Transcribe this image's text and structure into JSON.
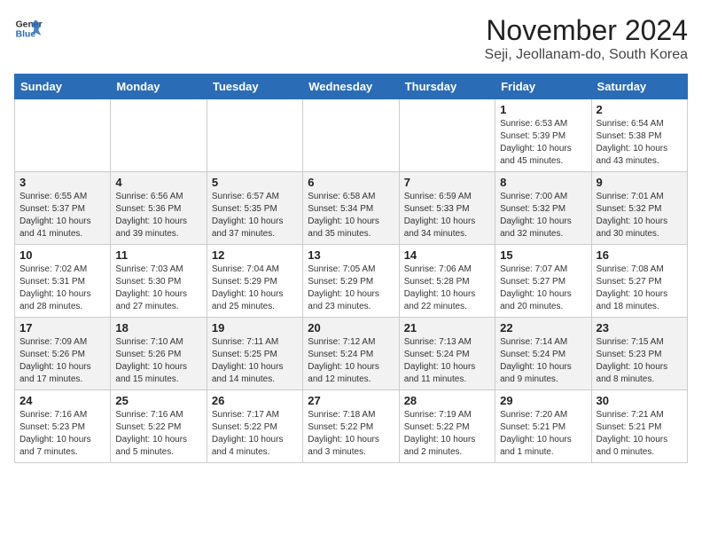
{
  "header": {
    "logo_line1": "General",
    "logo_line2": "Blue",
    "month": "November 2024",
    "location": "Seji, Jeollanam-do, South Korea"
  },
  "weekdays": [
    "Sunday",
    "Monday",
    "Tuesday",
    "Wednesday",
    "Thursday",
    "Friday",
    "Saturday"
  ],
  "weeks": [
    [
      {
        "day": "",
        "info": ""
      },
      {
        "day": "",
        "info": ""
      },
      {
        "day": "",
        "info": ""
      },
      {
        "day": "",
        "info": ""
      },
      {
        "day": "",
        "info": ""
      },
      {
        "day": "1",
        "info": "Sunrise: 6:53 AM\nSunset: 5:39 PM\nDaylight: 10 hours\nand 45 minutes."
      },
      {
        "day": "2",
        "info": "Sunrise: 6:54 AM\nSunset: 5:38 PM\nDaylight: 10 hours\nand 43 minutes."
      }
    ],
    [
      {
        "day": "3",
        "info": "Sunrise: 6:55 AM\nSunset: 5:37 PM\nDaylight: 10 hours\nand 41 minutes."
      },
      {
        "day": "4",
        "info": "Sunrise: 6:56 AM\nSunset: 5:36 PM\nDaylight: 10 hours\nand 39 minutes."
      },
      {
        "day": "5",
        "info": "Sunrise: 6:57 AM\nSunset: 5:35 PM\nDaylight: 10 hours\nand 37 minutes."
      },
      {
        "day": "6",
        "info": "Sunrise: 6:58 AM\nSunset: 5:34 PM\nDaylight: 10 hours\nand 35 minutes."
      },
      {
        "day": "7",
        "info": "Sunrise: 6:59 AM\nSunset: 5:33 PM\nDaylight: 10 hours\nand 34 minutes."
      },
      {
        "day": "8",
        "info": "Sunrise: 7:00 AM\nSunset: 5:32 PM\nDaylight: 10 hours\nand 32 minutes."
      },
      {
        "day": "9",
        "info": "Sunrise: 7:01 AM\nSunset: 5:32 PM\nDaylight: 10 hours\nand 30 minutes."
      }
    ],
    [
      {
        "day": "10",
        "info": "Sunrise: 7:02 AM\nSunset: 5:31 PM\nDaylight: 10 hours\nand 28 minutes."
      },
      {
        "day": "11",
        "info": "Sunrise: 7:03 AM\nSunset: 5:30 PM\nDaylight: 10 hours\nand 27 minutes."
      },
      {
        "day": "12",
        "info": "Sunrise: 7:04 AM\nSunset: 5:29 PM\nDaylight: 10 hours\nand 25 minutes."
      },
      {
        "day": "13",
        "info": "Sunrise: 7:05 AM\nSunset: 5:29 PM\nDaylight: 10 hours\nand 23 minutes."
      },
      {
        "day": "14",
        "info": "Sunrise: 7:06 AM\nSunset: 5:28 PM\nDaylight: 10 hours\nand 22 minutes."
      },
      {
        "day": "15",
        "info": "Sunrise: 7:07 AM\nSunset: 5:27 PM\nDaylight: 10 hours\nand 20 minutes."
      },
      {
        "day": "16",
        "info": "Sunrise: 7:08 AM\nSunset: 5:27 PM\nDaylight: 10 hours\nand 18 minutes."
      }
    ],
    [
      {
        "day": "17",
        "info": "Sunrise: 7:09 AM\nSunset: 5:26 PM\nDaylight: 10 hours\nand 17 minutes."
      },
      {
        "day": "18",
        "info": "Sunrise: 7:10 AM\nSunset: 5:26 PM\nDaylight: 10 hours\nand 15 minutes."
      },
      {
        "day": "19",
        "info": "Sunrise: 7:11 AM\nSunset: 5:25 PM\nDaylight: 10 hours\nand 14 minutes."
      },
      {
        "day": "20",
        "info": "Sunrise: 7:12 AM\nSunset: 5:24 PM\nDaylight: 10 hours\nand 12 minutes."
      },
      {
        "day": "21",
        "info": "Sunrise: 7:13 AM\nSunset: 5:24 PM\nDaylight: 10 hours\nand 11 minutes."
      },
      {
        "day": "22",
        "info": "Sunrise: 7:14 AM\nSunset: 5:24 PM\nDaylight: 10 hours\nand 9 minutes."
      },
      {
        "day": "23",
        "info": "Sunrise: 7:15 AM\nSunset: 5:23 PM\nDaylight: 10 hours\nand 8 minutes."
      }
    ],
    [
      {
        "day": "24",
        "info": "Sunrise: 7:16 AM\nSunset: 5:23 PM\nDaylight: 10 hours\nand 7 minutes."
      },
      {
        "day": "25",
        "info": "Sunrise: 7:16 AM\nSunset: 5:22 PM\nDaylight: 10 hours\nand 5 minutes."
      },
      {
        "day": "26",
        "info": "Sunrise: 7:17 AM\nSunset: 5:22 PM\nDaylight: 10 hours\nand 4 minutes."
      },
      {
        "day": "27",
        "info": "Sunrise: 7:18 AM\nSunset: 5:22 PM\nDaylight: 10 hours\nand 3 minutes."
      },
      {
        "day": "28",
        "info": "Sunrise: 7:19 AM\nSunset: 5:22 PM\nDaylight: 10 hours\nand 2 minutes."
      },
      {
        "day": "29",
        "info": "Sunrise: 7:20 AM\nSunset: 5:21 PM\nDaylight: 10 hours\nand 1 minute."
      },
      {
        "day": "30",
        "info": "Sunrise: 7:21 AM\nSunset: 5:21 PM\nDaylight: 10 hours\nand 0 minutes."
      }
    ]
  ]
}
